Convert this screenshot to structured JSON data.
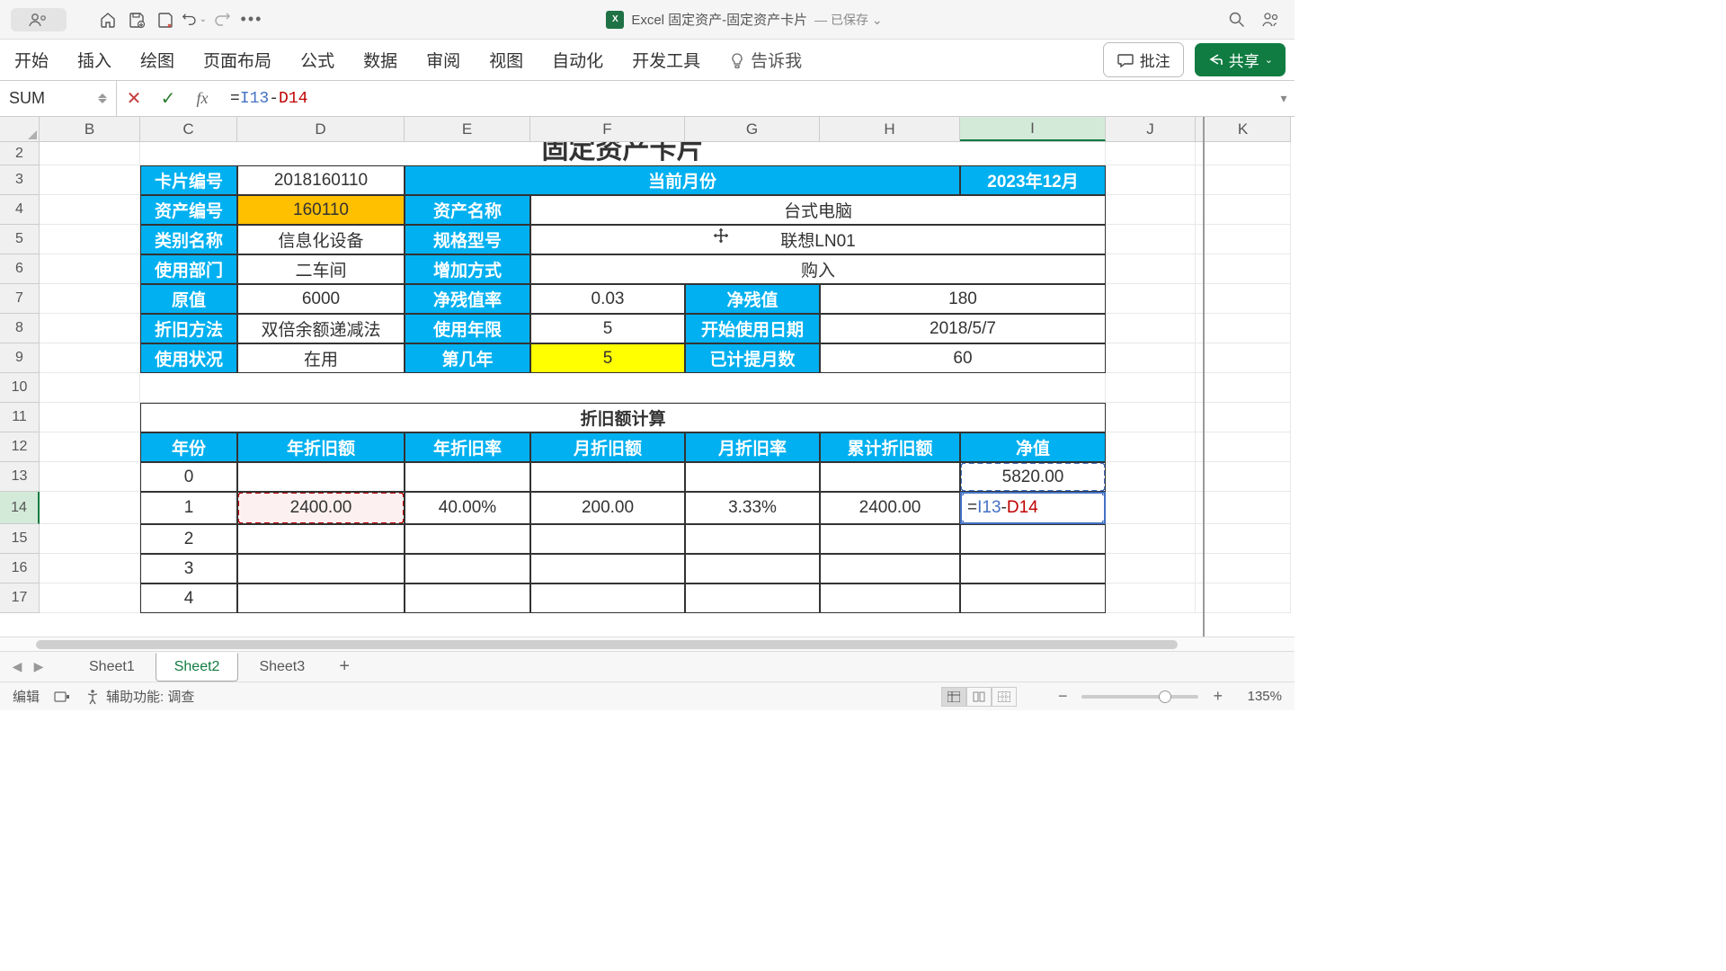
{
  "titlebar": {
    "doc_title": "Excel 固定资产-固定资产卡片",
    "saved_state": "— 已保存 ⌄"
  },
  "ribbon": {
    "tabs": [
      "开始",
      "插入",
      "绘图",
      "页面布局",
      "公式",
      "数据",
      "审阅",
      "视图",
      "自动化",
      "开发工具"
    ],
    "tell_me": "告诉我",
    "comments": "批注",
    "share": "共享"
  },
  "formulabar": {
    "namebox": "SUM",
    "fx": "fx",
    "formula_eq": "=",
    "formula_ref1": "I13",
    "formula_op": "-",
    "formula_ref2": "D14"
  },
  "columns": [
    "B",
    "C",
    "D",
    "E",
    "F",
    "G",
    "H",
    "I",
    "J",
    "K"
  ],
  "rows": [
    2,
    3,
    4,
    5,
    6,
    7,
    8,
    9,
    10,
    11,
    12,
    13,
    14,
    15,
    16,
    17
  ],
  "card": {
    "title": "固定资产卡片",
    "labels": {
      "card_no": "卡片编号",
      "cur_month": "当前月份",
      "asset_no": "资产编号",
      "asset_name": "资产名称",
      "cat_name": "类别名称",
      "spec": "规格型号",
      "dept": "使用部门",
      "add_way": "增加方式",
      "orig_val": "原值",
      "salvage_rate": "净残值率",
      "salvage_val": "净残值",
      "dep_method": "折旧方法",
      "life": "使用年限",
      "start_date": "开始使用日期",
      "status": "使用状况",
      "year_no": "第几年",
      "months": "已计提月数"
    },
    "values": {
      "card_no": "2018160110",
      "cur_month": "2023年12月",
      "asset_no": "160110",
      "asset_name": "台式电脑",
      "cat_name": "信息化设备",
      "spec": "联想LN01",
      "dept": "二车间",
      "add_way": "购入",
      "orig_val": "6000",
      "salvage_rate": "0.03",
      "salvage_val": "180",
      "dep_method": "双倍余额递减法",
      "life": "5",
      "start_date": "2018/5/7",
      "status": "在用",
      "year_no": "5",
      "months": "60"
    }
  },
  "dep_table": {
    "title": "折旧额计算",
    "headers": {
      "year": "年份",
      "amount": "年折旧额",
      "rate": "年折旧率",
      "m_amount": "月折旧额",
      "m_rate": "月折旧率",
      "cum": "累计折旧额",
      "net": "净值"
    },
    "rows": [
      {
        "year": "0",
        "amount": "",
        "rate": "",
        "m_amount": "",
        "m_rate": "",
        "cum": "",
        "net": "5820.00"
      },
      {
        "year": "1",
        "amount": "2400.00",
        "rate": "40.00%",
        "m_amount": "200.00",
        "m_rate": "3.33%",
        "cum": "2400.00",
        "net": "=I13-D14"
      },
      {
        "year": "2",
        "amount": "",
        "rate": "",
        "m_amount": "",
        "m_rate": "",
        "cum": "",
        "net": ""
      },
      {
        "year": "3",
        "amount": "",
        "rate": "",
        "m_amount": "",
        "m_rate": "",
        "cum": "",
        "net": ""
      },
      {
        "year": "4",
        "amount": "",
        "rate": "",
        "m_amount": "",
        "m_rate": "",
        "cum": "",
        "net": ""
      }
    ]
  },
  "sheets": {
    "tabs": [
      "Sheet1",
      "Sheet2",
      "Sheet3"
    ],
    "active": "Sheet2"
  },
  "statusbar": {
    "mode": "编辑",
    "ax": "辅助功能: 调查",
    "zoom": "135%"
  }
}
